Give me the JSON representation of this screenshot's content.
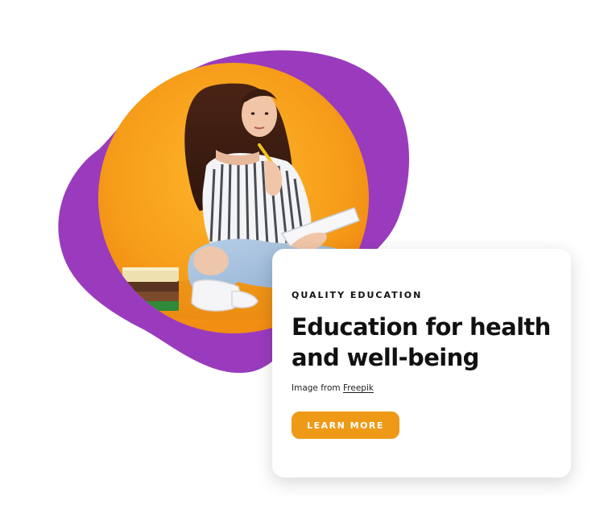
{
  "hero": {
    "image_alt": "Young woman sitting cross-legged with a notebook and pencil beside a stack of books",
    "blob_color": "#9a3bbd",
    "circle_color": "#f6a21c"
  },
  "card": {
    "eyebrow": "QUALITY EDUCATION",
    "title": "Education for health and well-being",
    "credit_prefix": "Image from ",
    "credit_link": "Freepik",
    "button_label": "LEARN MORE",
    "button_color": "#ee9a17"
  }
}
